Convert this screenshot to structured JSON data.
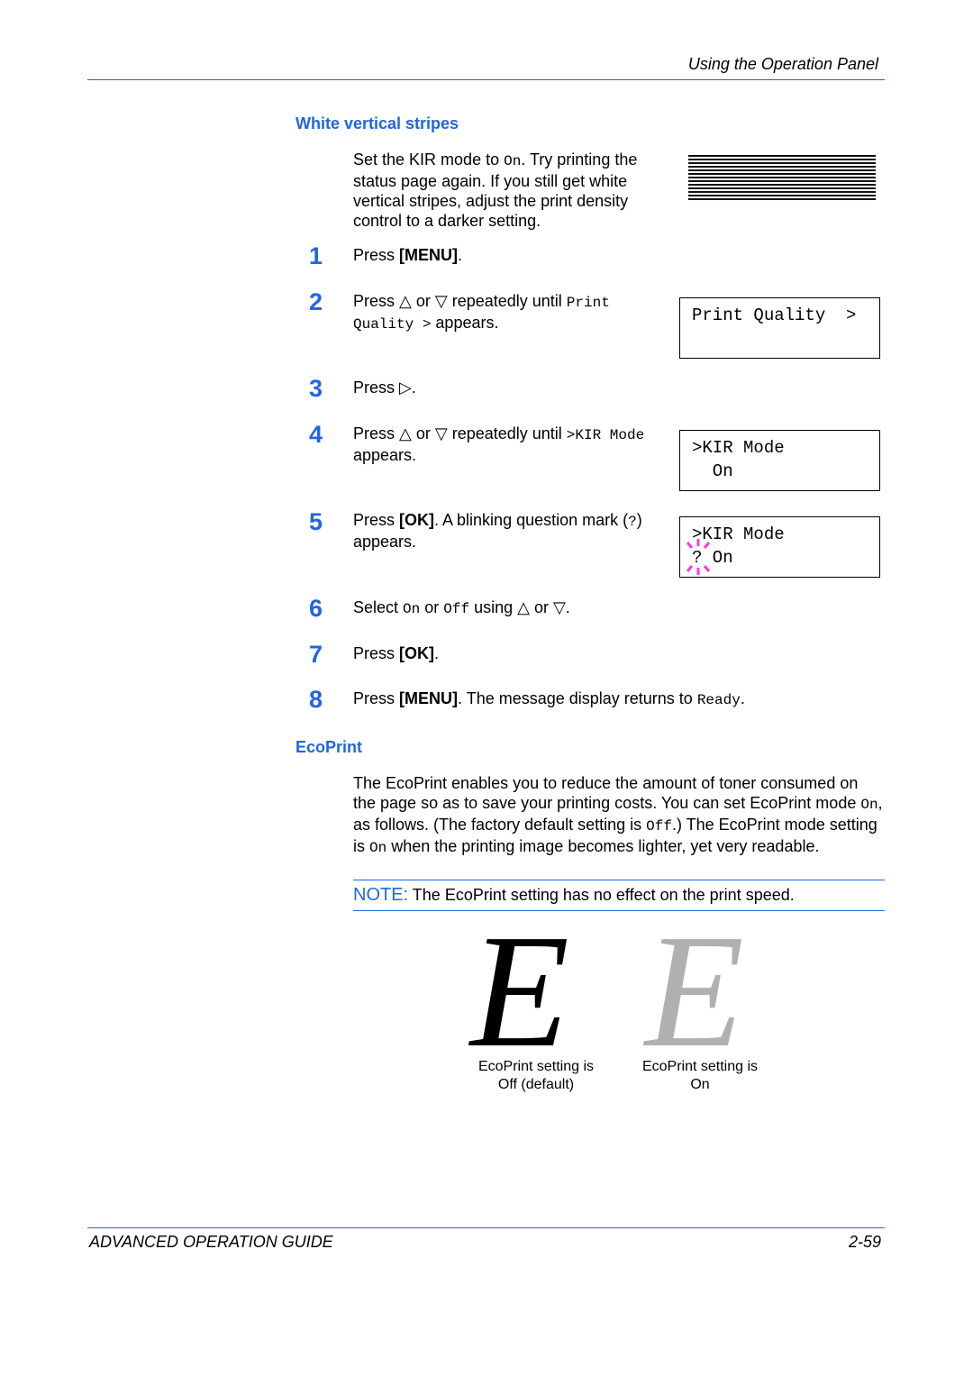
{
  "header": {
    "title": "Using the Operation Panel"
  },
  "section1": {
    "heading": "White vertical stripes",
    "intro": {
      "a": "Set the KIR mode to ",
      "b": "On",
      "c": ". Try printing the status page again. If you still get white vertical stripes, adjust the print density control to a darker setting."
    },
    "steps": [
      {
        "n": "1",
        "a": "Press ",
        "b": "[MENU]",
        "c": "."
      },
      {
        "n": "2",
        "a": "Press △ or ▽ repeatedly until ",
        "b": "Print Quality >",
        "c": " appears."
      },
      {
        "n": "3",
        "a": "Press ▷."
      },
      {
        "n": "4",
        "a": "Press △ or ▽ repeatedly until ",
        "b": ">KIR Mode",
        "c": " appears."
      },
      {
        "n": "5",
        "a": "Press ",
        "b": "[OK]",
        "c": ". A blinking question mark (",
        "d": "?",
        "e": ") appears."
      },
      {
        "n": "6",
        "a": "Select ",
        "b": "On",
        "c": " or ",
        "d": "Off",
        "e": " using △ or ▽."
      },
      {
        "n": "7",
        "a": "Press ",
        "b": "[OK]",
        "c": "."
      },
      {
        "n": "8",
        "a": "Press ",
        "b": "[MENU]",
        "c": ". The message display returns to ",
        "d": "Ready",
        "e": "."
      }
    ],
    "lcd": [
      {
        "line1": "Print Quality  >",
        "line2": ""
      },
      {
        "line1": ">KIR Mode",
        "line2": "  On"
      },
      {
        "line1": ">KIR Mode",
        "line2": "? On"
      }
    ]
  },
  "section2": {
    "heading": "EcoPrint",
    "body": {
      "a": "The EcoPrint enables you to reduce the amount of toner consumed on the page so as to save your printing costs. You can set EcoPrint mode ",
      "b": "On",
      "c": ", as follows. (The factory default setting is ",
      "d": "Off",
      "e": ".) The EcoPrint mode setting is ",
      "f": "On",
      "g": " when the printing image becomes lighter, yet very readable."
    },
    "note": {
      "label": "NOTE:",
      "text": " The EcoPrint setting has no effect on the print speed."
    },
    "samples": [
      {
        "glyph": "E",
        "caption1": "EcoPrint setting is",
        "caption2": "Off (default)",
        "color": "#000000"
      },
      {
        "glyph": "E",
        "caption1": "EcoPrint setting is",
        "caption2": "On",
        "color": "#b0b0b0"
      }
    ]
  },
  "footer": {
    "left": "ADVANCED OPERATION GUIDE",
    "right": "2-59"
  },
  "colors": {
    "accent": "#1f66e5",
    "blink": "#ff33ee"
  }
}
